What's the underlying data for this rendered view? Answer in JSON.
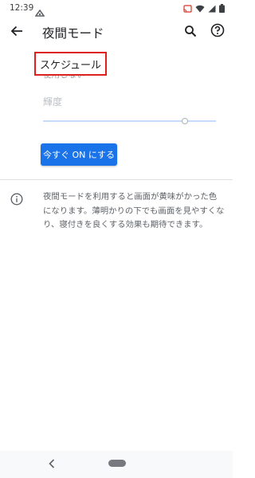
{
  "status_bar": {
    "time": "12:39",
    "icons": [
      "app-notification-icon",
      "cast-icon",
      "wifi-icon",
      "signal-icon",
      "battery-icon"
    ]
  },
  "app_bar": {
    "title": "夜間モード",
    "back_icon": "arrow-back-icon",
    "search_icon": "search-icon",
    "help_icon": "help-icon"
  },
  "schedule": {
    "label": "スケジュール",
    "value": "使用しない",
    "highlight_color": "#e0201f"
  },
  "brightness": {
    "label": "輝度",
    "level": 0.82
  },
  "activate_button": {
    "label": "今すぐ ON にする",
    "color": "#1a73e8"
  },
  "info": {
    "icon": "info-icon",
    "text": "夜間モードを利用すると画面が黄味がかった色になります。薄明かりの下でも画面を見やすくなり、寝付きを良くする効果も期待できます。"
  },
  "nav_bar": {
    "back_icon": "nav-back-icon",
    "home_icon": "nav-home-pill-icon"
  }
}
